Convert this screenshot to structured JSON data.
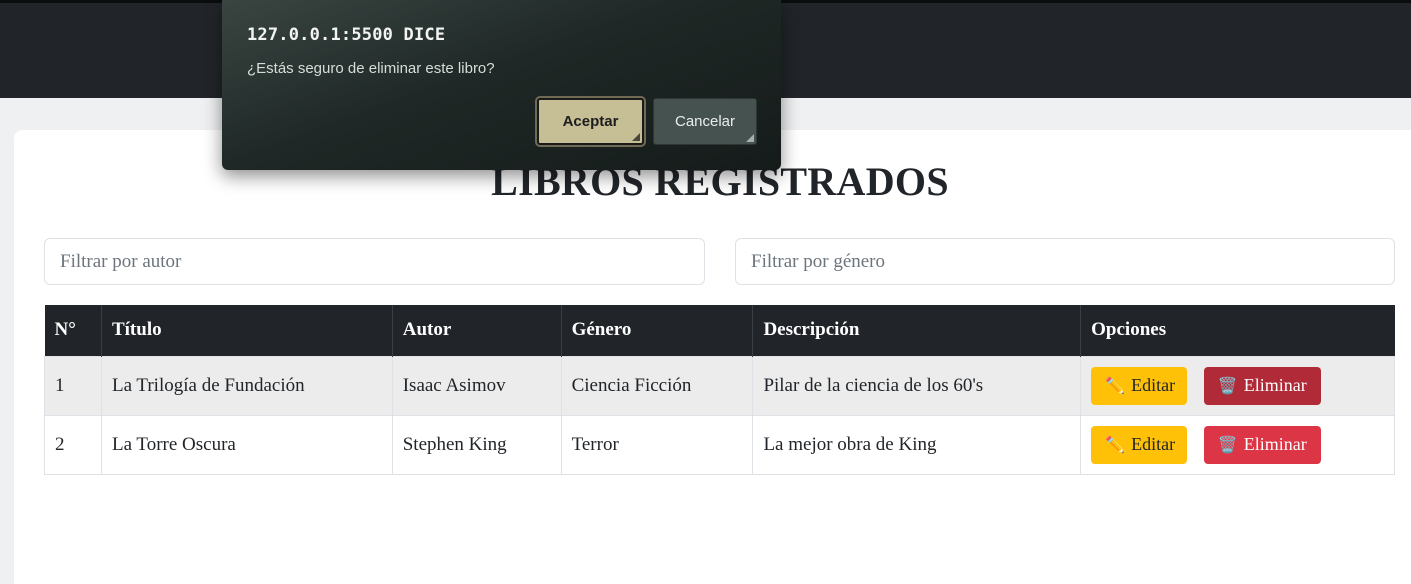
{
  "page": {
    "title": "LIBROS REGISTRADOS"
  },
  "filters": {
    "author_placeholder": "Filtrar por autor",
    "genre_placeholder": "Filtrar por género"
  },
  "table": {
    "headers": [
      "N°",
      "Título",
      "Autor",
      "Género",
      "Descripción",
      "Opciones"
    ],
    "rows": [
      {
        "num": "1",
        "title": "La Trilogía de Fundación",
        "author": "Isaac Asimov",
        "genre": "Ciencia Ficción",
        "description": "Pilar de la ciencia de los 60's"
      },
      {
        "num": "2",
        "title": "La Torre Oscura",
        "author": "Stephen King",
        "genre": "Terror",
        "description": "La mejor obra de King"
      }
    ],
    "edit_label": "Editar",
    "delete_label": "Eliminar"
  },
  "dialog": {
    "title": "127.0.0.1:5500 DICE",
    "message": "¿Estás seguro de eliminar este libro?",
    "accept_label": "Aceptar",
    "cancel_label": "Cancelar"
  },
  "colors": {
    "navbar": "#212529",
    "edit_button": "#ffc107",
    "delete_button": "#dc3545",
    "dialog_accept": "#c6be95"
  },
  "icons": {
    "edit": "pencil-icon",
    "delete": "wastebasket-icon"
  }
}
